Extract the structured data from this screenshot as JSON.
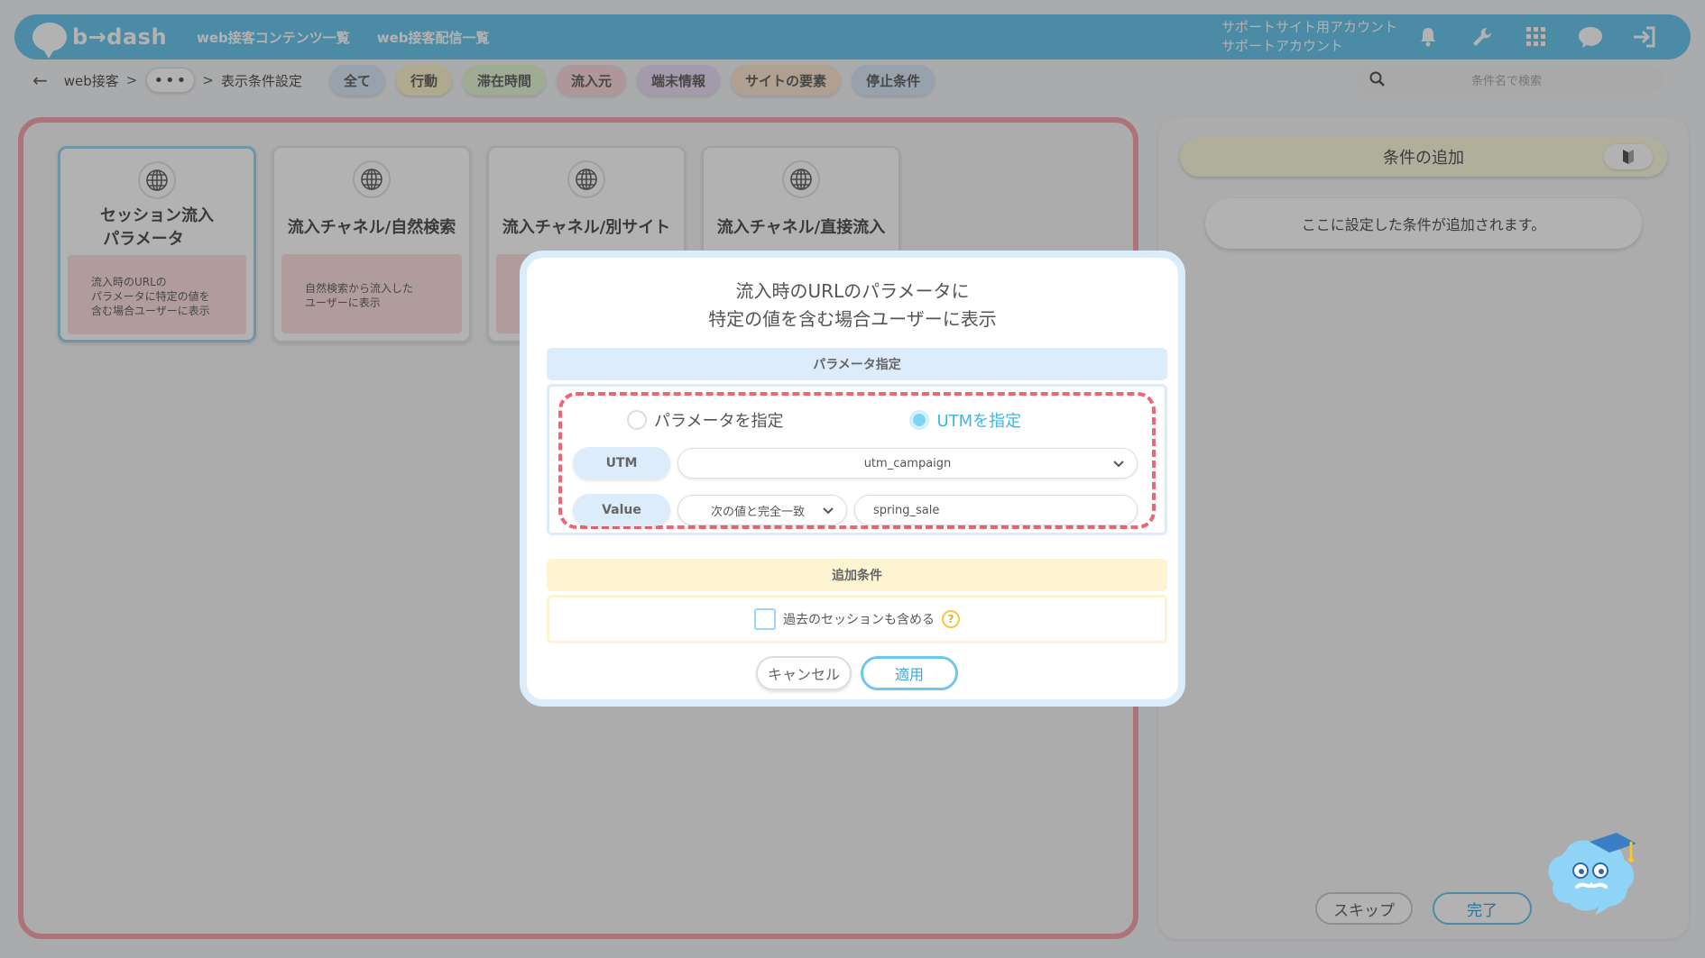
{
  "header": {
    "brand": "b→dash",
    "nav": [
      "web接客コンテンツ一覧",
      "web接客配信一覧"
    ],
    "account_line1": "サポートサイト用アカウント",
    "account_line2": "サポートアカウント",
    "icons": [
      "bell-icon",
      "wrench-icon",
      "grid-icon",
      "chat-icon",
      "logout-icon"
    ]
  },
  "subbar": {
    "breadcrumb_root": "web接客",
    "breadcrumb_sep": ">",
    "breadcrumb_current": "表示条件設定",
    "ellipsis": "•••",
    "chips": [
      {
        "label": "全て",
        "color": "#d8e8f8"
      },
      {
        "label": "行動",
        "color": "#fbf4cc"
      },
      {
        "label": "滞在時間",
        "color": "#e6f5d5"
      },
      {
        "label": "流入元",
        "color": "#fbd9dc"
      },
      {
        "label": "端末情報",
        "color": "#eadff5"
      },
      {
        "label": "サイトの要素",
        "color": "#fde6d2"
      },
      {
        "label": "停止条件",
        "color": "#d8e8f8"
      }
    ],
    "search_placeholder": "条件名で検索"
  },
  "cards": [
    {
      "title_line1": "セッション流入",
      "title_line2": "パラメータ",
      "desc_lines": [
        "流入時のURLの",
        "パラメータに特定の値を",
        "含む場合ユーザーに表示"
      ]
    },
    {
      "title_line1": "流入チャネル/自然検索",
      "title_line2": "",
      "desc_lines": [
        "自然検索から流入した",
        "ユーザーに表示"
      ]
    },
    {
      "title_line1": "流入チャネル/別サイト",
      "title_line2": "",
      "desc_lines": []
    },
    {
      "title_line1": "流入チャネル/直接流入",
      "title_line2": "",
      "desc_lines": []
    }
  ],
  "right_panel": {
    "title": "条件の追加",
    "empty_text": "ここに設定した条件が追加されます。",
    "skip": "スキップ",
    "done": "完了"
  },
  "modal": {
    "title_line1": "流入時のURLのパラメータに",
    "title_line2": "特定の値を含む場合ユーザーに表示",
    "param_section": "パラメータ指定",
    "radio_param": "パラメータを指定",
    "radio_utm": "UTMを指定",
    "utm_label": "UTM",
    "utm_value": "utm_campaign",
    "value_label": "Value",
    "match_value": "次の値と完全一致",
    "value_input": "spring_sale",
    "extra_section": "追加条件",
    "checkbox_label": "過去のセッションも含める",
    "help": "?",
    "cancel": "キャンセル",
    "apply": "適用"
  },
  "colors": {
    "header_bg": "#6ec7ec",
    "accent_red": "#ee6673",
    "accent_blue": "#3aa7d8"
  }
}
